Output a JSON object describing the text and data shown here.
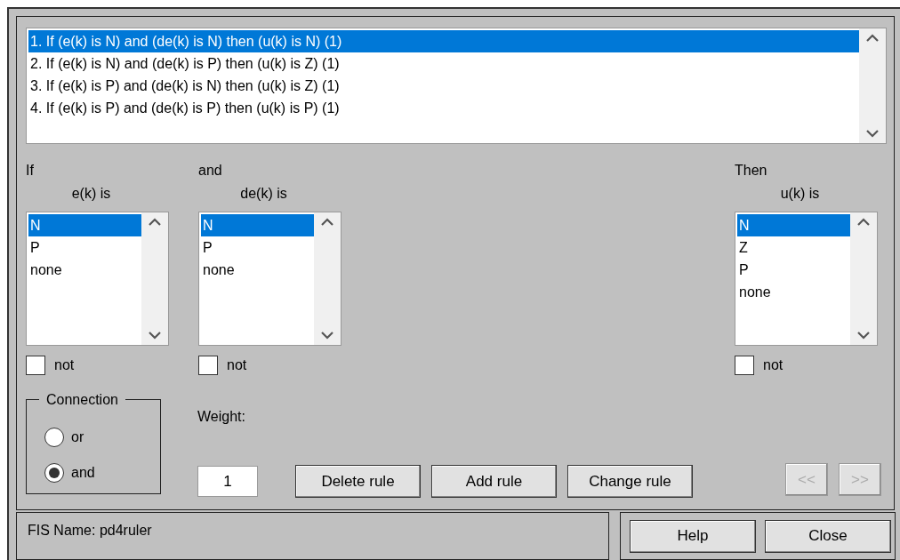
{
  "rules": [
    {
      "text": "1. If (e(k) is N) and (de(k) is N) then (u(k) is N) (1)",
      "selected": true
    },
    {
      "text": "2. If (e(k) is N) and (de(k) is P) then (u(k) is Z) (1)",
      "selected": false
    },
    {
      "text": "3. If (e(k) is P) and (de(k) is N) then (u(k) is Z) (1)",
      "selected": false
    },
    {
      "text": "4. If (e(k) is P) and (de(k) is P) then (u(k) is P) (1)",
      "selected": false
    }
  ],
  "columns": [
    {
      "kind": "input",
      "heading": "If",
      "label": "e(k) is",
      "not": false,
      "not_label": "not",
      "options": [
        {
          "label": "N",
          "selected": true
        },
        {
          "label": "P",
          "selected": false
        },
        {
          "label": "none",
          "selected": false
        }
      ]
    },
    {
      "kind": "input",
      "heading": "and",
      "label": "de(k) is",
      "not": false,
      "not_label": "not",
      "options": [
        {
          "label": "N",
          "selected": true
        },
        {
          "label": "P",
          "selected": false
        },
        {
          "label": "none",
          "selected": false
        }
      ]
    },
    {
      "kind": "output",
      "heading": "Then",
      "label": "u(k) is",
      "not": false,
      "not_label": "not",
      "options": [
        {
          "label": "N",
          "selected": true
        },
        {
          "label": "Z",
          "selected": false
        },
        {
          "label": "P",
          "selected": false
        },
        {
          "label": "none",
          "selected": false
        }
      ]
    }
  ],
  "connection": {
    "label": "Connection",
    "options": [
      {
        "label": "or",
        "selected": false
      },
      {
        "label": "and",
        "selected": true
      }
    ]
  },
  "weight": {
    "label": "Weight:",
    "value": "1"
  },
  "buttons": [
    "Delete rule",
    "Add rule",
    "Change rule"
  ],
  "nav_buttons": [
    {
      "label": "<<",
      "disabled": true
    },
    {
      "label": ">>",
      "disabled": true
    }
  ],
  "fis_name": "FIS Name: pd4ruler",
  "footer_buttons": [
    "Help",
    "Close"
  ]
}
